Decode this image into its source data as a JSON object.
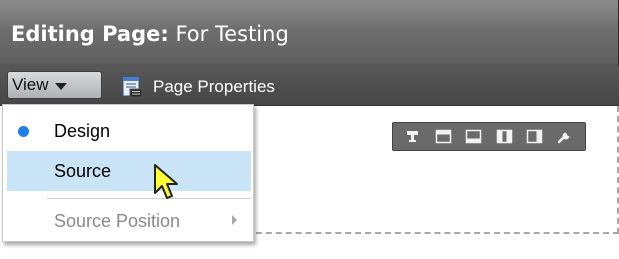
{
  "header": {
    "title_prefix": "Editing Page:",
    "page_name": "For Testing"
  },
  "toolbar": {
    "view_label": "View",
    "page_properties_label": "Page Properties"
  },
  "view_menu": {
    "items": [
      {
        "label": "Design",
        "selected": true
      },
      {
        "label": "Source",
        "highlighted": true
      },
      {
        "label": "Source Position",
        "disabled": true,
        "has_submenu": true
      }
    ]
  },
  "layout_toolbar": {
    "icons": [
      "pin-icon",
      "header-layout-icon",
      "footer-layout-icon",
      "column-layout-icon",
      "sidebar-layout-icon",
      "wrench-icon"
    ]
  },
  "colors": {
    "selection_bullet": "#1f7fe5",
    "highlight_bg": "#c9e3f7",
    "cursor_fill": "#ffff33"
  }
}
